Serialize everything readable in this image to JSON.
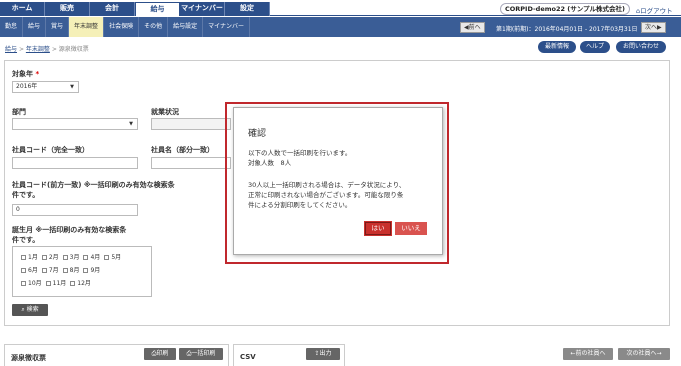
{
  "topnav": {
    "tabs": [
      "ホーム",
      "販売",
      "会計",
      "給与",
      "マイナンバー",
      "設定"
    ],
    "active_tab": "給与",
    "company": "CORPID-demo22 (サンプル株式会社)",
    "logout": "ログアウト"
  },
  "subnav": {
    "items": [
      "勤怠",
      "給与",
      "賞与",
      "年末調整",
      "社会保険",
      "その他",
      "給与設定",
      "マイナンバー"
    ],
    "active_item": "年末調整",
    "prev_label": "前へ",
    "period": "第1期(前期)：2016年04月01日 - 2017年03月31日",
    "next_label": "次へ"
  },
  "breadcrumb": {
    "root": "給与",
    "parent": "年末調整",
    "current": "源泉徴収票"
  },
  "top_buttons": {
    "whats_new": "最新情報",
    "help": "ヘルプ",
    "contact": "お問い合わせ"
  },
  "form": {
    "year_label": "対象年",
    "year_required_mark": "*",
    "year_value": "2016年",
    "department_label": "部門",
    "employment_label": "就業状況",
    "code_exact_label": "社員コード（完全一致）",
    "name_partial_label": "社員名（部分一致）",
    "code_prefix_label_line1": "社員コード(前方一致) ※一括印刷のみ有効な検索条",
    "code_prefix_label_line2": "件です。",
    "code_prefix_value": "0",
    "birth_month_label_line1": "誕生月 ※一括印刷のみ有効な検索条",
    "birth_month_label_line2": "件です。",
    "months": [
      "1月",
      "2月",
      "3月",
      "4月",
      "5月",
      "6月",
      "7月",
      "8月",
      "9月",
      "10月",
      "11月",
      "12月"
    ],
    "search_button": "検索"
  },
  "bottom": {
    "withholding_title": "源泉徴収票",
    "print_button": "印刷",
    "bulk_print_button": "一括印刷",
    "csv_title": "CSV",
    "export_button": "出力",
    "prev_employee": "←前の社員へ",
    "next_employee": "次の社員へ→"
  },
  "modal": {
    "title": "確認",
    "line1": "以下の人数で一括印刷を行います。",
    "line2": "対象人数　8人",
    "line3": "30人以上一括印刷される場合は、データ状況により、",
    "line4": "正常に印刷されない場合がございます。可能な限り条",
    "line5": "件による分割印刷をしてください。",
    "yes_label": "はい",
    "no_label": "いいえ"
  }
}
